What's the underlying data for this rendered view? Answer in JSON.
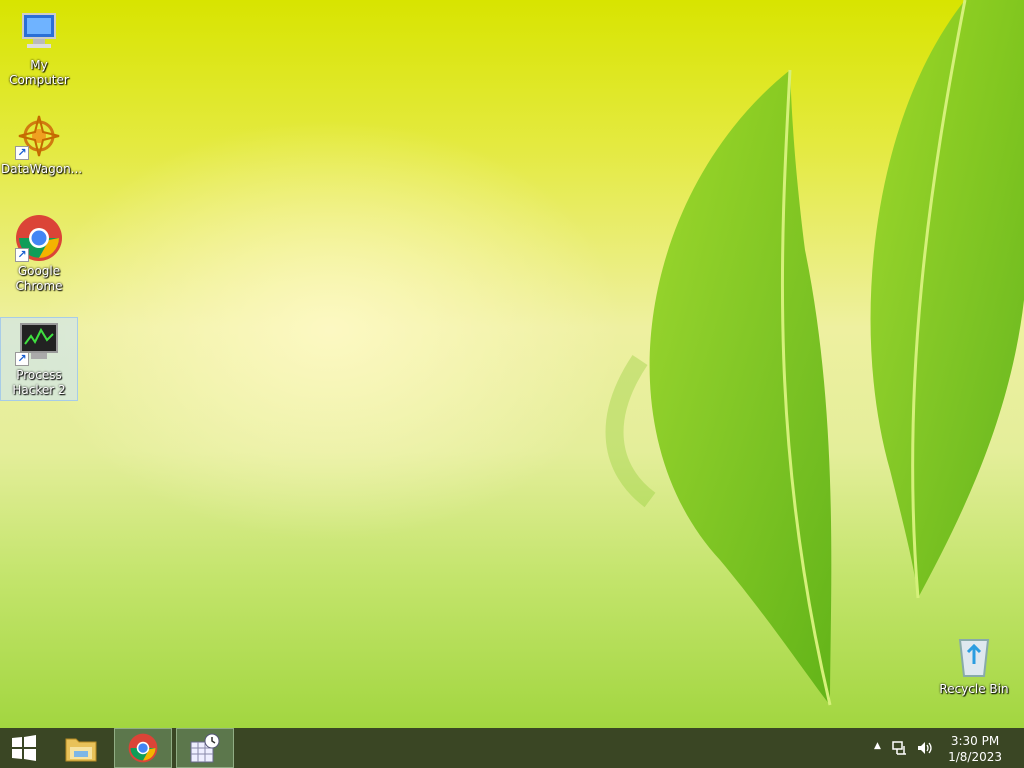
{
  "desktop": {
    "icons": [
      {
        "label": "My Computer"
      },
      {
        "label": "DataWagon..."
      },
      {
        "label": "Google Chrome"
      },
      {
        "label": "Process Hacker 2"
      },
      {
        "label": "Recycle Bin"
      }
    ]
  },
  "taskbar": {
    "clock": {
      "time": "3:30 PM",
      "date": "1/8/2023"
    },
    "colors": {
      "background": "#3a4624",
      "active_button": "#7aa06e"
    }
  }
}
